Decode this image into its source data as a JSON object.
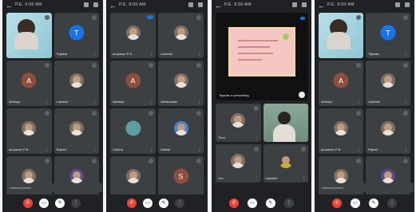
{
  "panels": [
    {
      "title": "P.E. 9:00 AM",
      "tiles": [
        {
          "type": "self",
          "name": "",
          "mic": "gray"
        },
        {
          "type": "letter",
          "letter": "T",
          "color": "#1a73e8",
          "name": "Tejadas",
          "mic": "gray"
        },
        {
          "type": "letter",
          "letter": "A",
          "color": "#8d4f3c",
          "name": "Abhidya",
          "mic": "gray"
        },
        {
          "type": "photo",
          "name": "Lakshmi",
          "mic": "gray"
        },
        {
          "type": "photo",
          "name": "aruyanan P N",
          "mic": "gray"
        },
        {
          "type": "photo",
          "name": "Rajesh",
          "mic": "gray"
        },
        {
          "type": "photo",
          "name": "",
          "mic": "gray"
        },
        {
          "type": "photo",
          "name": "",
          "mic": "gray"
        }
      ],
      "notice": "Lakshmi joined",
      "controls": [
        "end-call",
        "camera",
        "mic",
        "more"
      ]
    },
    {
      "title": "",
      "tiles": [
        {
          "type": "photo",
          "name": "aruyanan P N",
          "mic": "blue"
        },
        {
          "type": "photo",
          "name": "Lakshmi",
          "mic": "gray"
        },
        {
          "type": "letter",
          "letter": "A",
          "color": "#8d4f3c",
          "name": "Abhidya",
          "mic": "gray"
        },
        {
          "type": "photo",
          "name": "Abhinandan",
          "mic": "gray"
        },
        {
          "type": "letter",
          "letter": "",
          "color": "#5f9ea0",
          "name": "Chithra",
          "mic": "gray"
        },
        {
          "type": "photo",
          "name": "Adhish",
          "mic": "gray"
        },
        {
          "type": "photo",
          "name": "You",
          "mic": "gray"
        },
        {
          "type": "letter",
          "letter": "S",
          "color": "#8d4f3c",
          "name": "Sri Lalitha",
          "mic": "gray"
        }
      ],
      "notice": "",
      "controls": [
        "end-call",
        "camera",
        "mic",
        "more"
      ]
    },
    {
      "title": "P.E. 9:00 AM",
      "presenting": "Tejadas is presenting",
      "tiles": [
        {
          "type": "photo",
          "name": "Tumi",
          "mic": "gray"
        },
        {
          "type": "cam",
          "name": "",
          "mic": "gray"
        },
        {
          "type": "photo",
          "name": "You",
          "mic": "gray"
        },
        {
          "type": "photo",
          "name": "Lakshmi",
          "mic": "gray"
        }
      ],
      "notice": "",
      "controls": [
        "end-call",
        "camera",
        "mic",
        "more"
      ]
    },
    {
      "title": "P.E. 9:00 AM",
      "tiles": [
        {
          "type": "self",
          "name": "",
          "mic": "gray"
        },
        {
          "type": "letter",
          "letter": "T",
          "color": "#1a73e8",
          "name": "Tejadas",
          "mic": "gray"
        },
        {
          "type": "letter",
          "letter": "A",
          "color": "#8d4f3c",
          "name": "Abhidya",
          "mic": "gray"
        },
        {
          "type": "photo",
          "name": "Lakshmi",
          "mic": "gray"
        },
        {
          "type": "photo",
          "name": "aruyanan P N",
          "mic": "gray"
        },
        {
          "type": "photo",
          "name": "Rajesh",
          "mic": "gray"
        },
        {
          "type": "photo",
          "name": "",
          "mic": "gray"
        },
        {
          "type": "photo",
          "name": "",
          "mic": "gray"
        }
      ],
      "notice": "Lakshmi joined",
      "controls": [
        "end-call",
        "camera",
        "mic",
        "more"
      ]
    }
  ]
}
